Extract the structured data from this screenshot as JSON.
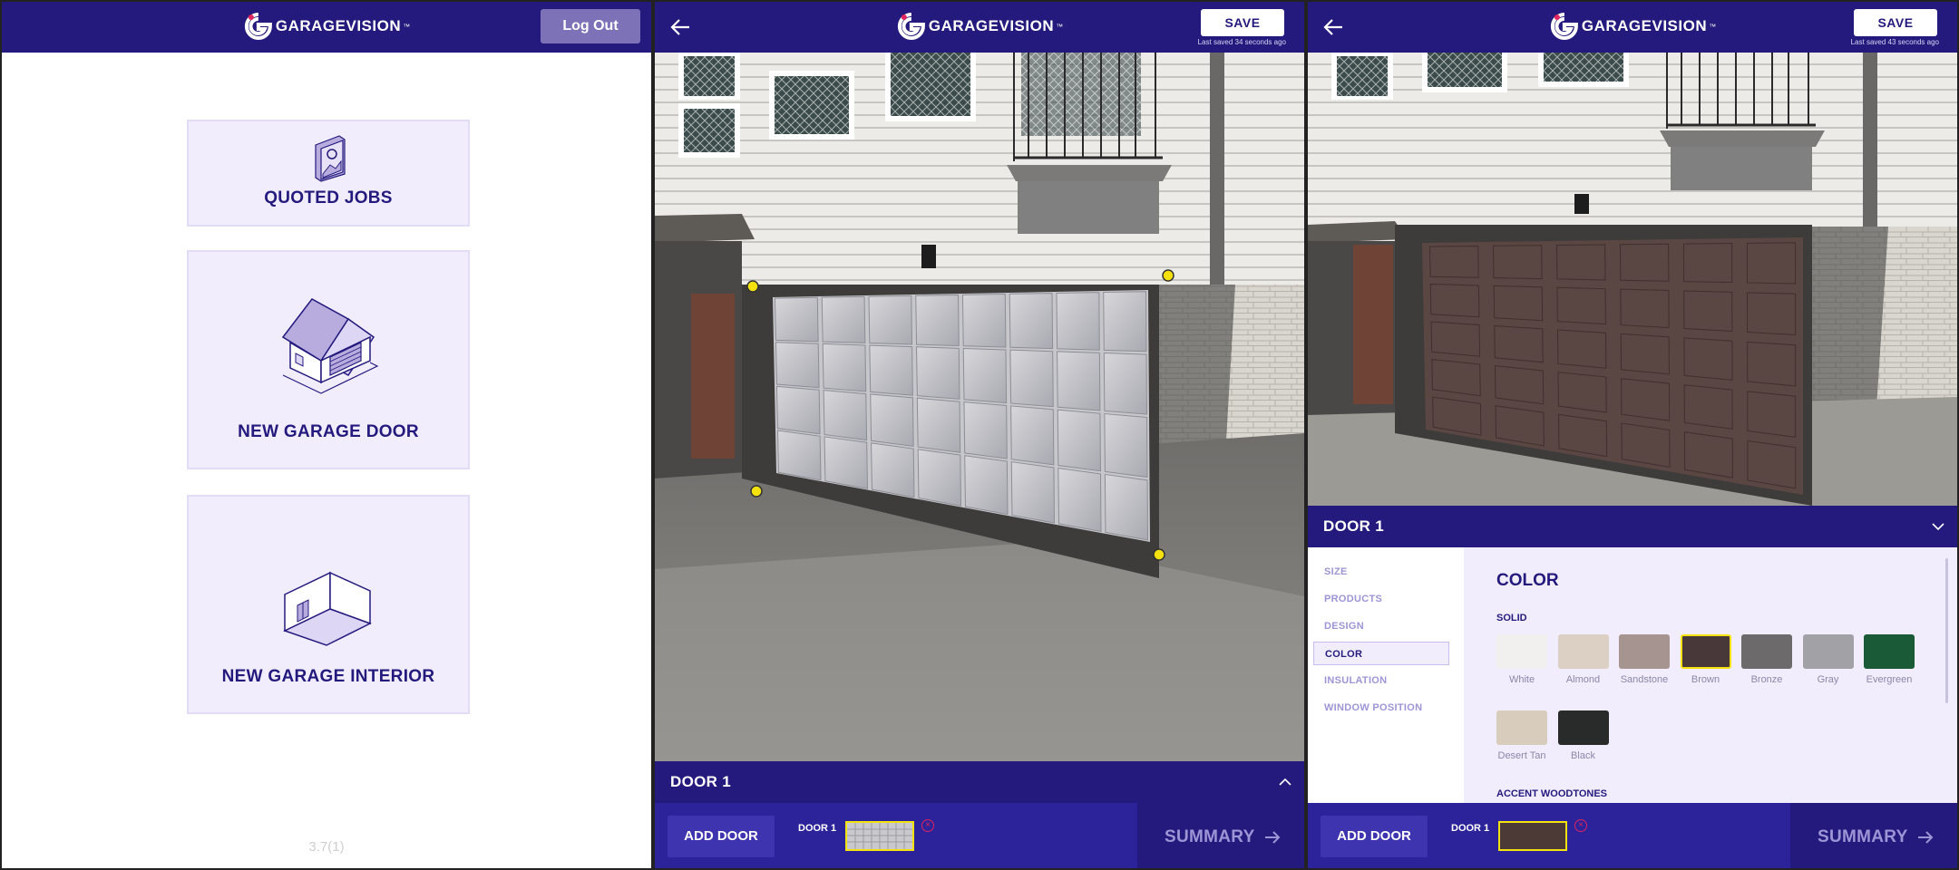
{
  "brand": {
    "name": "GARAGEVISION",
    "tm": "™"
  },
  "screen_home": {
    "logout_label": "Log Out",
    "menu": [
      {
        "label": "QUOTED JOBS",
        "icon": "photo-icon"
      },
      {
        "label": "NEW GARAGE DOOR",
        "icon": "house-garage-icon"
      },
      {
        "label": "NEW GARAGE INTERIOR",
        "icon": "room-interior-icon"
      }
    ],
    "version": "3.7(1)"
  },
  "screen_editor": {
    "save_label": "SAVE",
    "saved_note": "Last saved 34 seconds ago",
    "door_bar_label": "DOOR 1",
    "add_door_label": "ADD DOOR",
    "door_chip_label": "DOOR 1",
    "summary_label": "SUMMARY",
    "remove_symbol": "×",
    "marker_color": "#f4e20e"
  },
  "screen_color": {
    "save_label": "SAVE",
    "saved_note": "Last saved 43 seconds ago",
    "door_bar_label": "DOOR 1",
    "add_door_label": "ADD DOOR",
    "door_chip_label": "DOOR 1",
    "summary_label": "SUMMARY",
    "remove_symbol": "×",
    "nav": [
      "SIZE",
      "PRODUCTS",
      "DESIGN",
      "COLOR",
      "INSULATION",
      "WINDOW POSITION"
    ],
    "active_nav": "COLOR",
    "section_title": "COLOR",
    "subsection_solid": "SOLID",
    "subsection_accent": "ACCENT WOODTONES",
    "swatches": [
      {
        "name": "White",
        "color": "#f1f0ef"
      },
      {
        "name": "Almond",
        "color": "#dccfc4"
      },
      {
        "name": "Sandstone",
        "color": "#a59490"
      },
      {
        "name": "Brown",
        "color": "#48383a",
        "selected": true
      },
      {
        "name": "Bronze",
        "color": "#6c6a6a"
      },
      {
        "name": "Gray",
        "color": "#a2a1a6"
      },
      {
        "name": "Evergreen",
        "color": "#1a5a37"
      },
      {
        "name": "Desert Tan",
        "color": "#d8cdbd"
      },
      {
        "name": "Black",
        "color": "#292a2a"
      }
    ]
  },
  "colors": {
    "brand_navy": "#241a7e",
    "card_bg": "#f1edfc",
    "selected_outline": "#f4e20e",
    "remove_red": "#e0245e"
  }
}
